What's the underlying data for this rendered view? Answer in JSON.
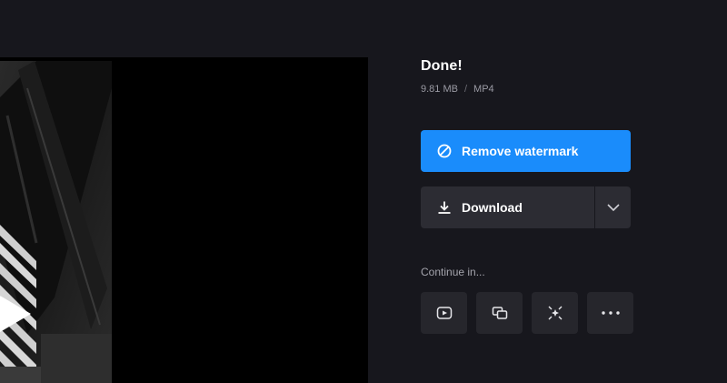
{
  "status": {
    "title": "Done!",
    "size": "9.81 MB",
    "separator": "/",
    "format": "MP4"
  },
  "actions": {
    "remove_watermark_label": "Remove watermark",
    "download_label": "Download"
  },
  "continue": {
    "label": "Continue in...",
    "apps": [
      {
        "icon": "play-square-icon"
      },
      {
        "icon": "stacked-frames-icon"
      },
      {
        "icon": "sparkle-compress-icon"
      },
      {
        "icon": "more-dots-icon"
      }
    ]
  },
  "colors": {
    "background": "#17171d",
    "primary": "#1a8cfb",
    "secondary_button": "#2c2c33",
    "app_tile": "#26262c",
    "muted_text": "#9a9aa3"
  }
}
